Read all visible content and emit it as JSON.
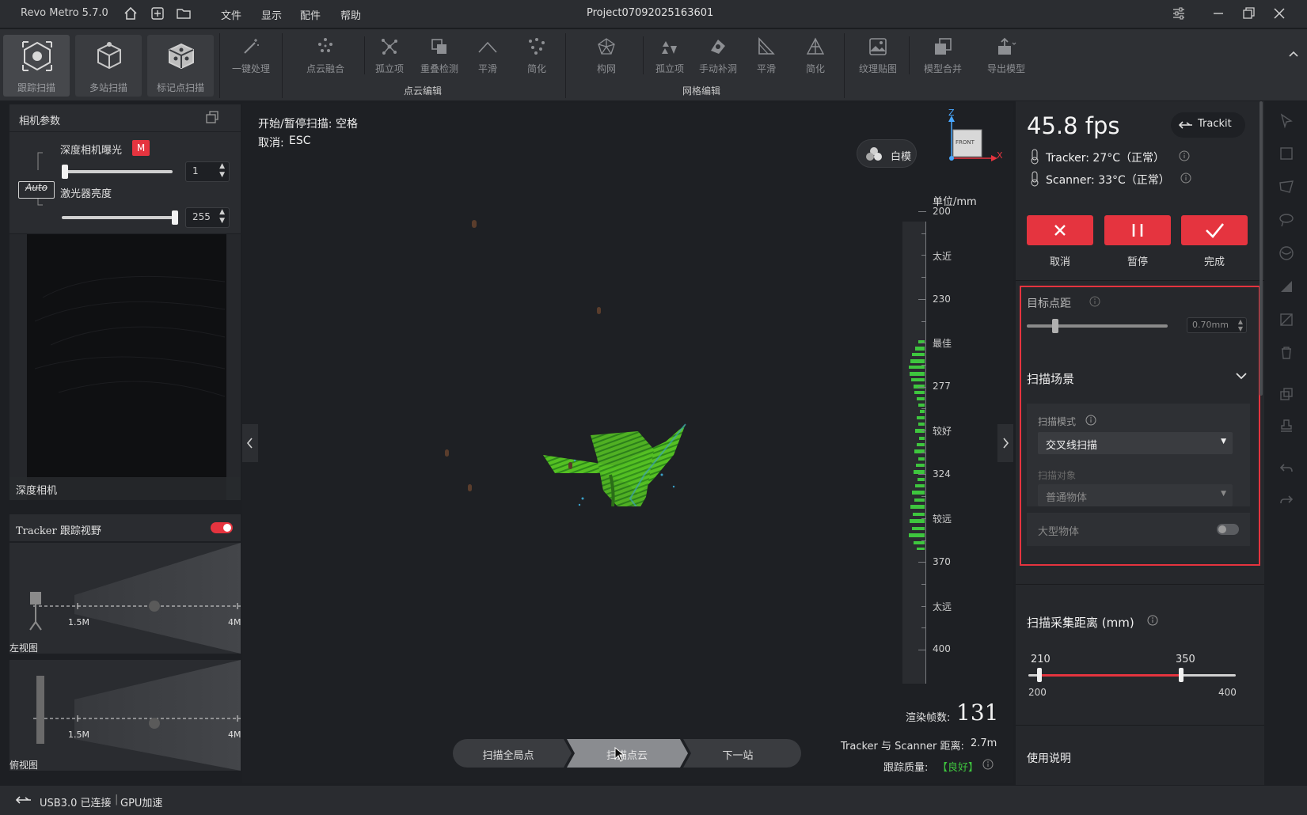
{
  "titlebar": {
    "app": "Revo Metro 5.7.0",
    "menu": [
      "文件",
      "显示",
      "配件",
      "帮助"
    ],
    "project": "Project07092025163601"
  },
  "toolbar": {
    "scan_modes": [
      "跟踪扫描",
      "多站扫描",
      "标记点扫描"
    ],
    "one_click": "一键处理",
    "pointcloud_tools": [
      "点云融合",
      "孤立项",
      "重叠检测",
      "平滑",
      "简化"
    ],
    "pointcloud_group": "点云编辑",
    "mesh_tools": [
      "构网",
      "孤立项",
      "手动补洞",
      "平滑",
      "简化"
    ],
    "mesh_group": "网格编辑",
    "extra_tools": [
      "纹理贴图",
      "模型合并",
      "导出模型"
    ]
  },
  "left": {
    "camera_params": "相机参数",
    "depth_exposure": "深度相机曝光",
    "exposure_mode": "M",
    "exposure_value": "1",
    "auto_label": "Auto",
    "laser_brightness": "激光器亮度",
    "laser_value": "255",
    "depth_camera": "深度相机",
    "tracker_view": "Tracker 跟踪视野",
    "left_view": "左视图",
    "top_view": "俯视图",
    "dist_near": "1.5M",
    "dist_far": "4M"
  },
  "viewport": {
    "hint_start_label": "开始/暂停扫描:",
    "hint_start_key": "空格",
    "hint_cancel_label": "取消:",
    "hint_cancel_key": "ESC",
    "white_model": "白模",
    "axis_z": "Z",
    "axis_x": "X",
    "front": "FRONT",
    "unit": "单位/mm",
    "ruler_numbers": [
      "200",
      "230",
      "277",
      "324",
      "370",
      "400"
    ],
    "ruler_zones": [
      "太近",
      "最佳",
      "较好",
      "较远",
      "太远"
    ],
    "render_fps_label": "渲染帧数:",
    "render_fps": "131",
    "distance_label": "Tracker 与 Scanner 距离:",
    "distance": "2.7m",
    "quality_label": "跟踪质量:",
    "quality": "【良好】",
    "steps": [
      "扫描全局点",
      "扫描点云",
      "下一站"
    ]
  },
  "right": {
    "fps": "45.8 fps",
    "trackit": "Trackit",
    "tracker_temp": "Tracker: 27°C（正常）",
    "scanner_temp": "Scanner: 33°C（正常）",
    "actions": [
      "取消",
      "暂停",
      "完成"
    ],
    "target_spacing": "目标点距",
    "spacing_value": "0.70mm",
    "spacing_level": 0.2,
    "scan_scene": "扫描场景",
    "scan_mode_label": "扫描模式",
    "scan_mode": "交叉线扫描",
    "scan_object_label": "扫描对象",
    "scan_object": "普通物体",
    "large_object": "大型物体",
    "large_object_on": false,
    "distance_title": "扫描采集距离 (mm)",
    "distance_low": "210",
    "distance_high": "350",
    "distance_min": "200",
    "distance_max": "400",
    "manual": "使用说明"
  },
  "status": {
    "connection": "USB3.0 已连接",
    "gpu": "GPU加速"
  },
  "colors": {
    "accent_red": "#e5343f",
    "good_green": "#3ec63e",
    "scan_green": "#5fd02a"
  }
}
